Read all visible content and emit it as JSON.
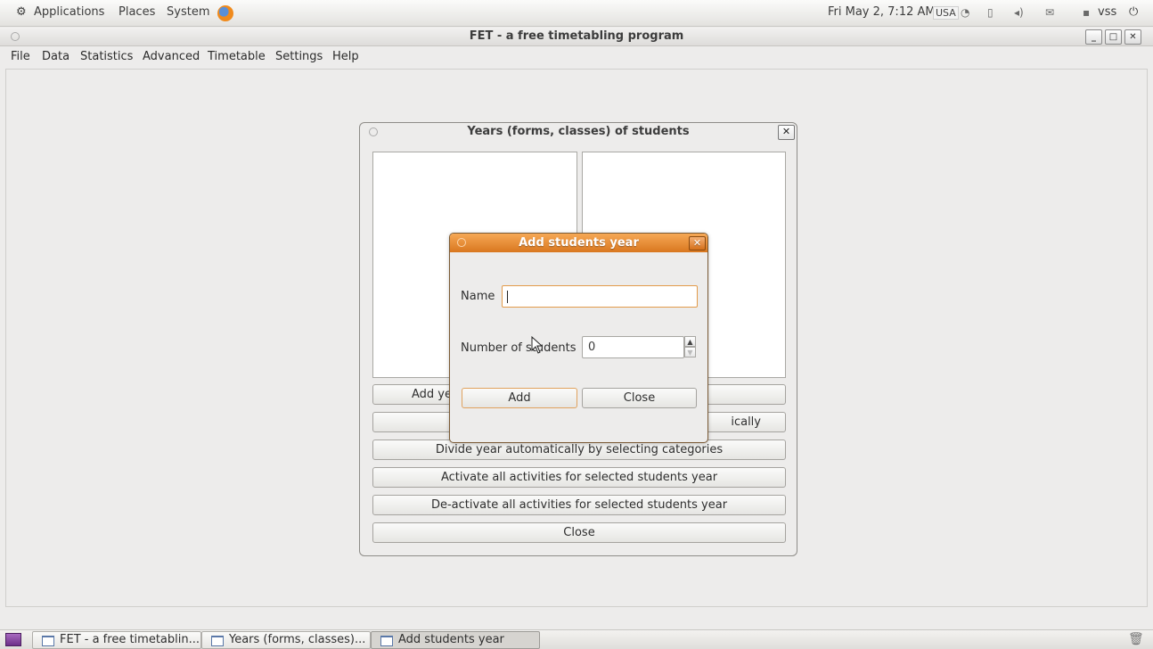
{
  "top_panel": {
    "menus": [
      "Applications",
      "Places",
      "System"
    ],
    "clock": "Fri May 2,  7:12 AM",
    "keyboard_layout": "USA",
    "user": "vss"
  },
  "main_window": {
    "title": "FET - a free timetabling program",
    "menu": [
      "File",
      "Data",
      "Statistics",
      "Advanced",
      "Timetable",
      "Settings",
      "Help"
    ]
  },
  "years_dialog": {
    "title": "Years (forms, classes) of students",
    "buttons": {
      "add_year": "Add ye",
      "modify_partial": "ically",
      "divide": "Divide year automatically by selecting categories",
      "activate": "Activate all activities for selected students year",
      "deactivate": "De-activate all activities for selected students year",
      "close": "Close"
    }
  },
  "add_dialog": {
    "title": "Add students year",
    "name_label": "Name",
    "name_value": "",
    "number_label": "Number of students",
    "number_value": "0",
    "add_label": "Add",
    "close_label": "Close"
  },
  "taskbar": {
    "tasks": [
      "FET - a free timetablin...",
      "Years (forms, classes)...",
      "Add students year"
    ]
  }
}
